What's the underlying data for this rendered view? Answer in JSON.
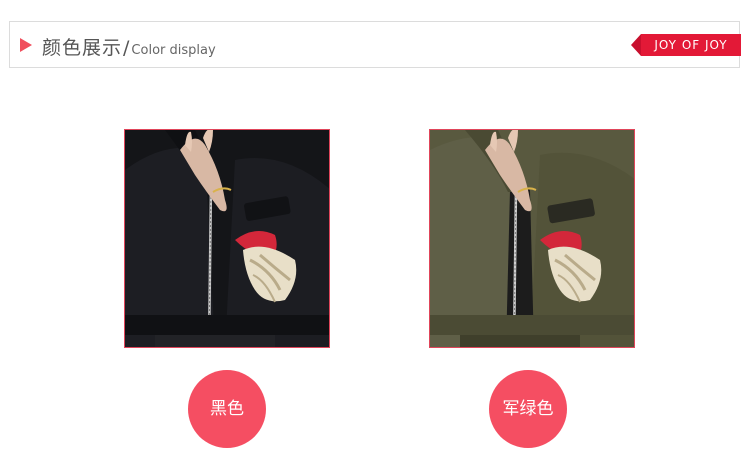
{
  "header": {
    "title_cn": "颜色展示",
    "slash": "/",
    "title_en": "Color display",
    "brand": "JOY OF JOY",
    "accent_color": "#f04e5c",
    "brand_color": "#e31937"
  },
  "swatches": [
    {
      "label": "黑色",
      "jacket_color": "#15161a",
      "picture": "black bomber jacket with floral embroidered sleeve"
    },
    {
      "label": "军绿色",
      "jacket_color": "#5a5a44",
      "picture": "army green bomber jacket with floral embroidered sleeve"
    }
  ],
  "badge_color": "#f54e62"
}
